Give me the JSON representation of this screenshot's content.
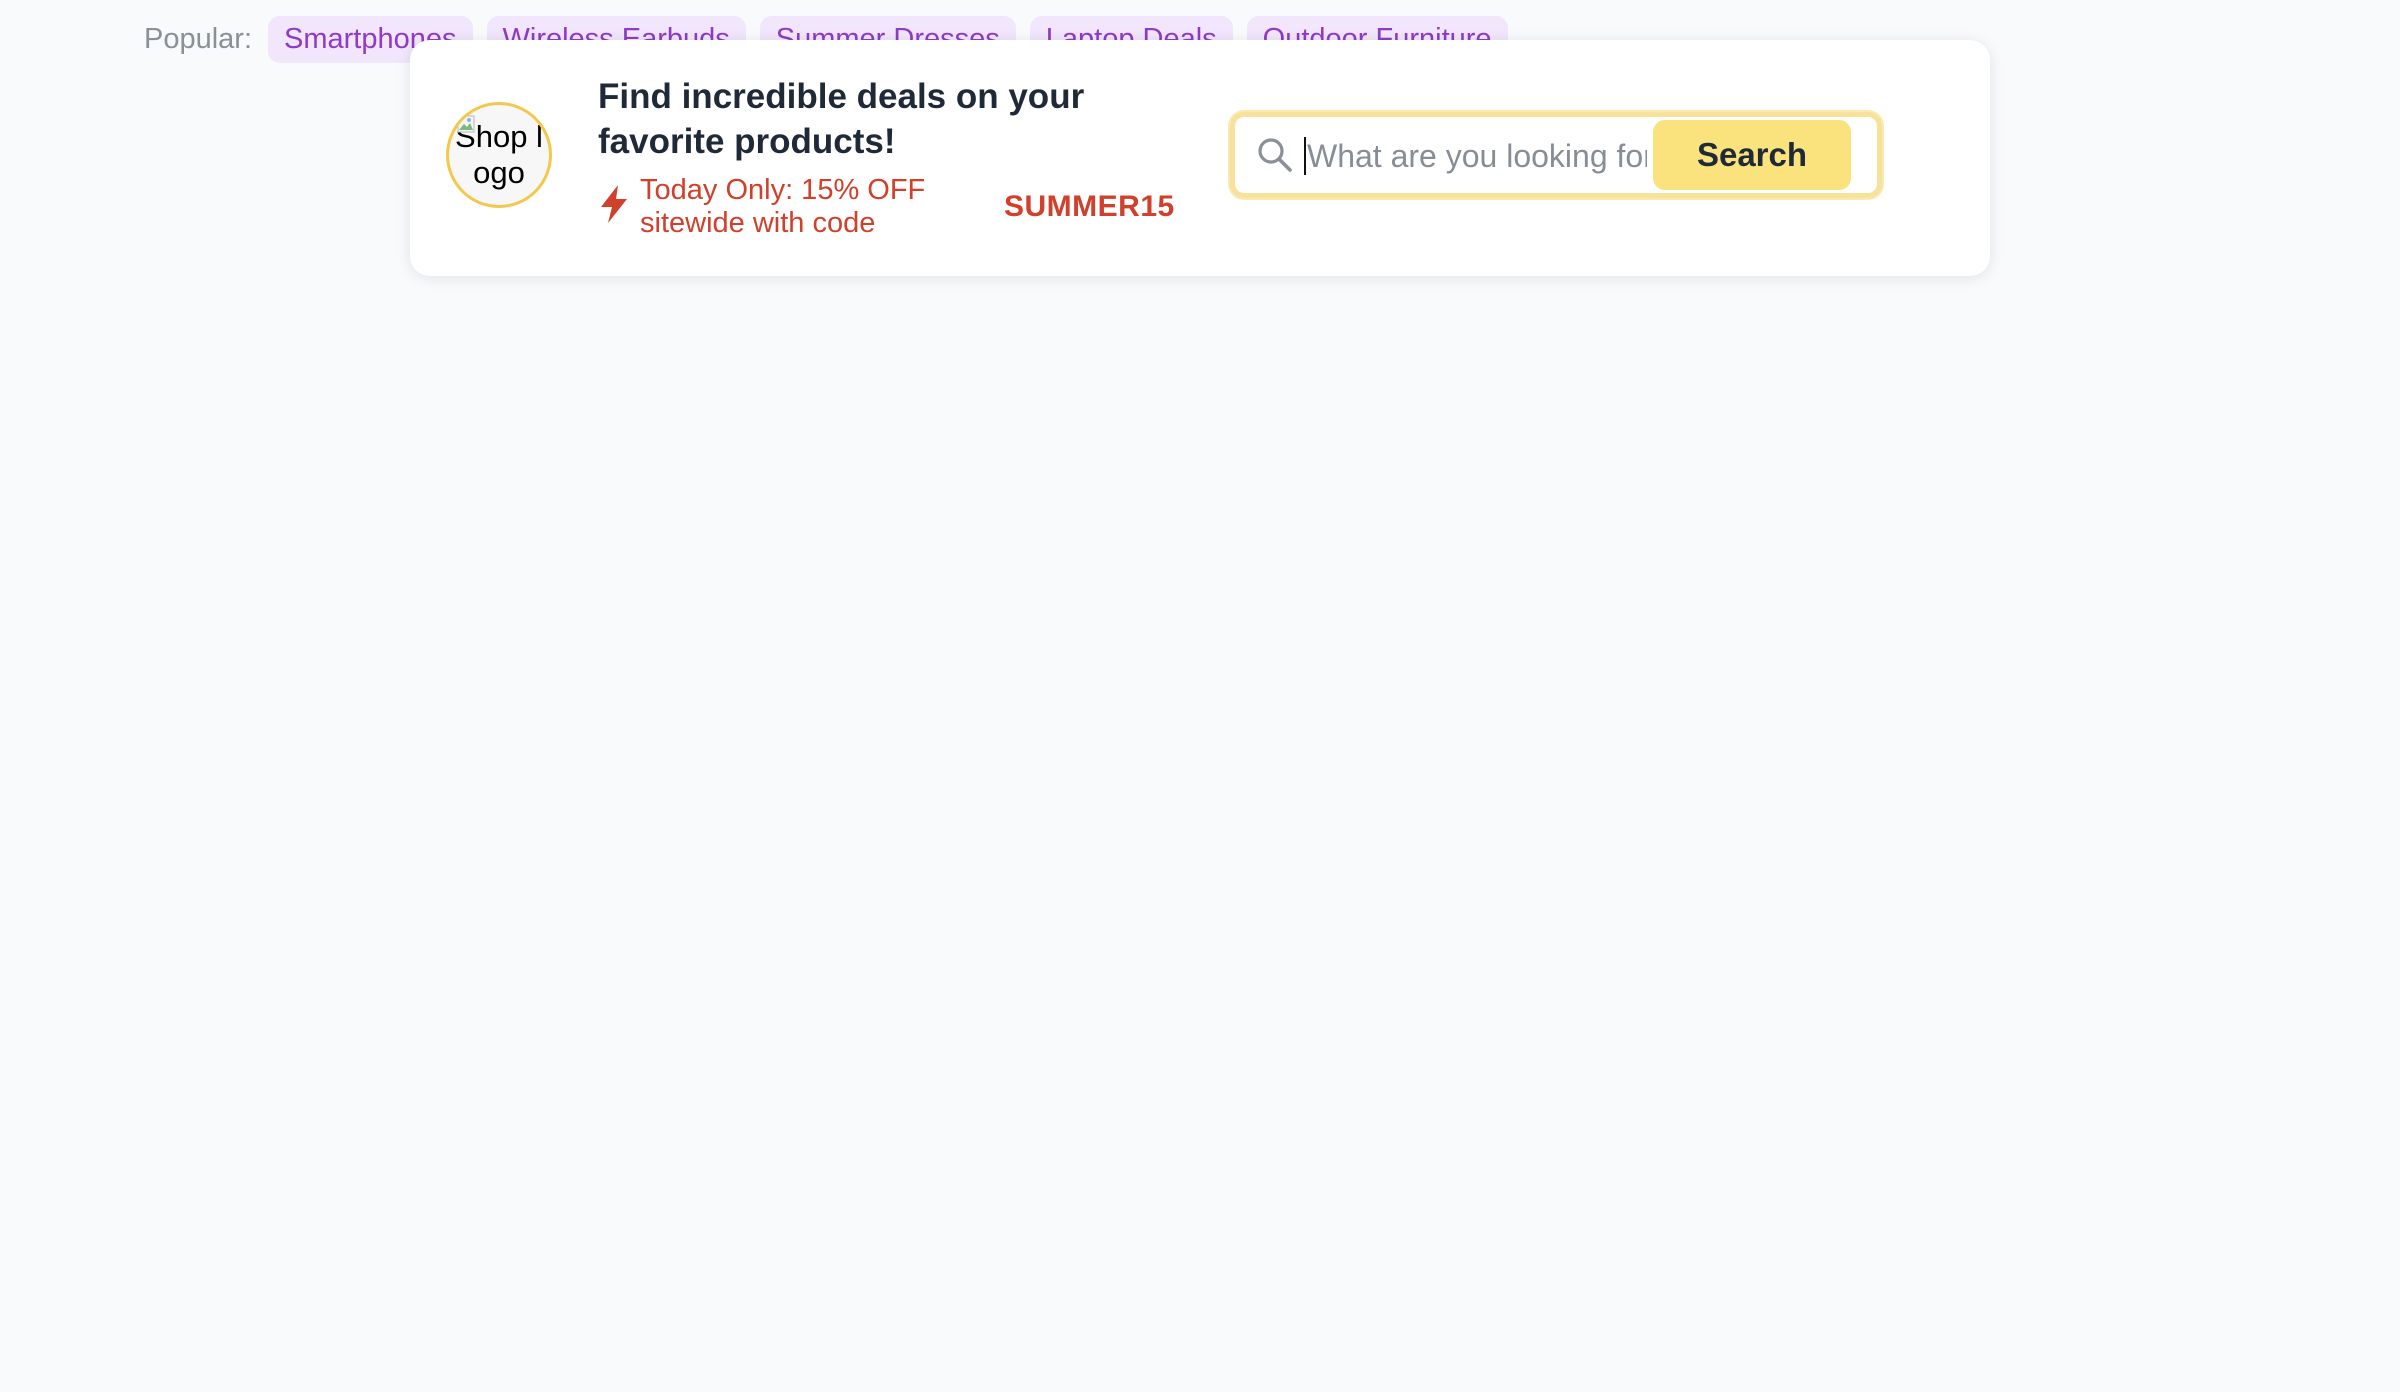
{
  "popular": {
    "label": "Popular:",
    "tags": [
      "Smartphones",
      "Wireless Earbuds",
      "Summer Dresses",
      "Laptop Deals",
      "Outdoor Furniture"
    ]
  },
  "promo_card": {
    "logo_alt": "Shop logo",
    "headline": "Find incredible deals on your favorite products!",
    "offer_text": "Today Only: 15% OFF sitewide with code",
    "promo_code": "SUMMER15",
    "search": {
      "placeholder": "What are you looking for?",
      "value": "",
      "button_label": "Search"
    }
  },
  "icons": {
    "offer": "lightning-bolt-icon",
    "search": "search-icon",
    "logo": "broken-image-icon"
  },
  "colors": {
    "accent_yellow": "#fae27c",
    "promo_red": "#d0402b",
    "tag_purple": "#8f3ac9",
    "tag_background": "#f1e6fb",
    "logo_border": "#f2c94c"
  }
}
